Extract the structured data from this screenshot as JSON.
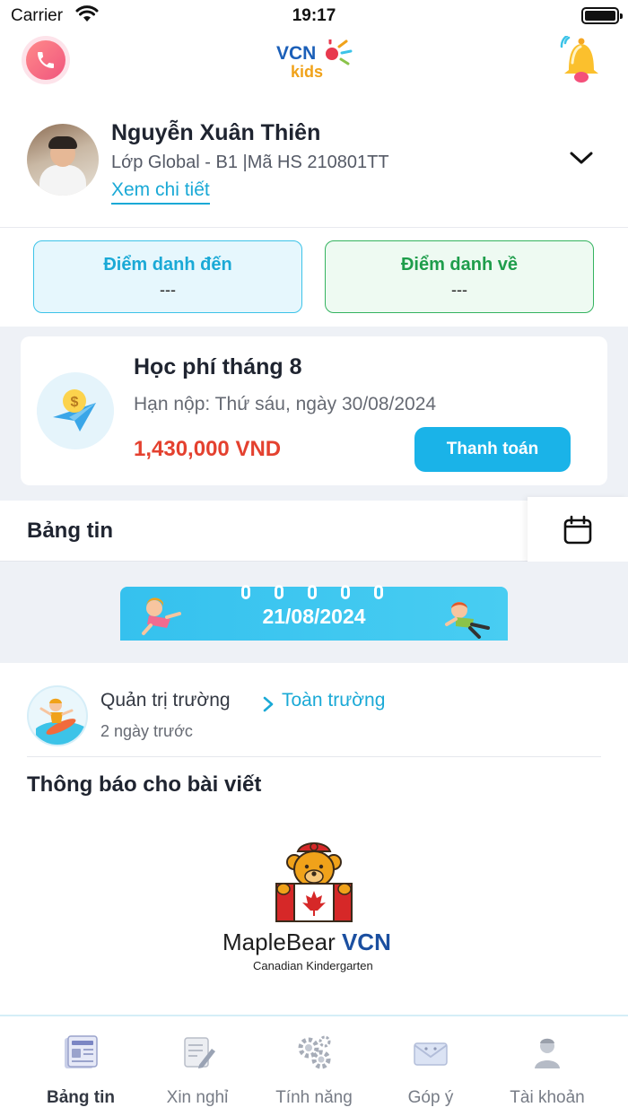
{
  "status_bar": {
    "carrier": "Carrier",
    "time": "19:17"
  },
  "header": {
    "logo_line1": "VCN",
    "logo_line2": "kids"
  },
  "profile": {
    "name": "Nguyễn Xuân Thiên",
    "class_info": "Lớp Global - B1 |Mã HS 210801TT",
    "view_detail": "Xem chi tiết"
  },
  "attendance": {
    "check_in_label": "Điểm danh đến",
    "check_in_value": "---",
    "check_out_label": "Điểm danh về",
    "check_out_value": "---"
  },
  "fee": {
    "title": "Học phí tháng 8",
    "deadline": "Hạn nộp: Thứ sáu, ngày 30/08/2024",
    "amount": "1,430,000 VND",
    "pay_label": "Thanh toán"
  },
  "news": {
    "title": "Bảng tin",
    "date": "21/08/2024"
  },
  "post": {
    "author": "Quản trị trường",
    "target": "Toàn trường",
    "time": "2 ngày trước",
    "title": "Thông báo cho bài viết",
    "brand_prefix": "MapleBear ",
    "brand_suffix": "VCN",
    "brand_sub": "Canadian Kindergarten"
  },
  "tabs": [
    {
      "label": "Bảng tin",
      "icon": "newspaper-icon",
      "active": true
    },
    {
      "label": "Xin nghỉ",
      "icon": "leave-request-icon",
      "active": false
    },
    {
      "label": "Tính năng",
      "icon": "gears-icon",
      "active": false
    },
    {
      "label": "Góp ý",
      "icon": "feedback-mail-icon",
      "active": false
    },
    {
      "label": "Tài khoản",
      "icon": "account-icon",
      "active": false
    }
  ],
  "colors": {
    "primary": "#1ab3e8",
    "link": "#1aa9d6",
    "success": "#1e9d4b",
    "danger": "#e4412f",
    "background_band": "#eef1f6"
  }
}
